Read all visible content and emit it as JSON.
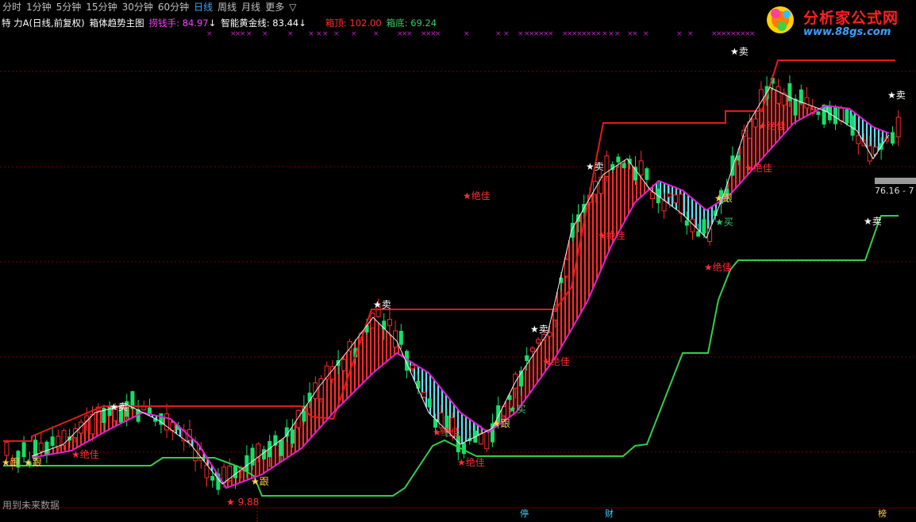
{
  "tabs": {
    "items": [
      "分时",
      "1分钟",
      "5分钟",
      "15分钟",
      "30分钟",
      "60分钟",
      "日线",
      "周线",
      "月线",
      "更多"
    ],
    "active": "日线",
    "more_arrow": "▽"
  },
  "info": {
    "stock": "特 力A(日线,前复权)",
    "indicator": "箱体趋势主图",
    "catcher_label": "捞钱手:",
    "catcher_value": "84.97",
    "catcher_arrow": "↓",
    "gold_label": "智能黄金线:",
    "gold_value": "83.44",
    "gold_arrow": "↓",
    "top_label": "箱顶:",
    "top_value": "102.00",
    "bottom_label": "箱底:",
    "bottom_value": "69.24"
  },
  "logo": {
    "title": "分析家公式网",
    "url": "www.88gs.com"
  },
  "footer_note": "用到未来数据",
  "price_tag": "76.16 - 7",
  "bottom_tags": [
    "停",
    "财",
    "榜"
  ],
  "markers": [
    {
      "text": "★跟",
      "color": "yellow"
    },
    {
      "text": "★跟",
      "color": "yellow"
    },
    {
      "text": "★绝佳",
      "color": "red"
    },
    {
      "text": "★卖",
      "color": "white"
    },
    {
      "text": "★ 9.88",
      "color": "red"
    },
    {
      "text": "★跟",
      "color": "yellow"
    },
    {
      "text": "★卖",
      "color": "white"
    },
    {
      "text": "★绝佳",
      "color": "red"
    },
    {
      "text": "★绝佳",
      "color": "red"
    },
    {
      "text": "★买",
      "color": "green"
    },
    {
      "text": "★跟",
      "color": "yellow"
    },
    {
      "text": "★卖",
      "color": "white"
    },
    {
      "text": "★绝佳",
      "color": "red"
    },
    {
      "text": "★卖",
      "color": "white"
    },
    {
      "text": "★绝佳",
      "color": "red"
    },
    {
      "text": "★卖",
      "color": "white"
    },
    {
      "text": "★绝佳",
      "color": "red"
    },
    {
      "text": "★跟",
      "color": "yellow"
    },
    {
      "text": "★买",
      "color": "green"
    },
    {
      "text": "★绝佳",
      "color": "red"
    },
    {
      "text": "★卖",
      "color": "white"
    },
    {
      "text": "★绝佳",
      "color": "red"
    },
    {
      "text": "★卖",
      "color": "white"
    },
    {
      "text": "★绝佳",
      "color": "red"
    }
  ],
  "colors": {
    "up": "#ff2a2a",
    "down": "#13e06a",
    "box_top": "#e31b1b",
    "box_bottom": "#2fd04a",
    "trend_line": "#e020d8",
    "ma_line": "#f0f0f0",
    "fill_up": "#ff2a2a",
    "fill_down": "#5fe0f0",
    "grid": "#7a0000",
    "cross": "#c020c0"
  },
  "chart_data": {
    "type": "candlestick",
    "title": "",
    "indicator_name": "箱体趋势主图",
    "summary": {
      "box_top": 102.0,
      "box_bottom": 69.24,
      "catcher": 84.97,
      "gold_line": 83.44,
      "low_mark": 9.88
    }
  }
}
